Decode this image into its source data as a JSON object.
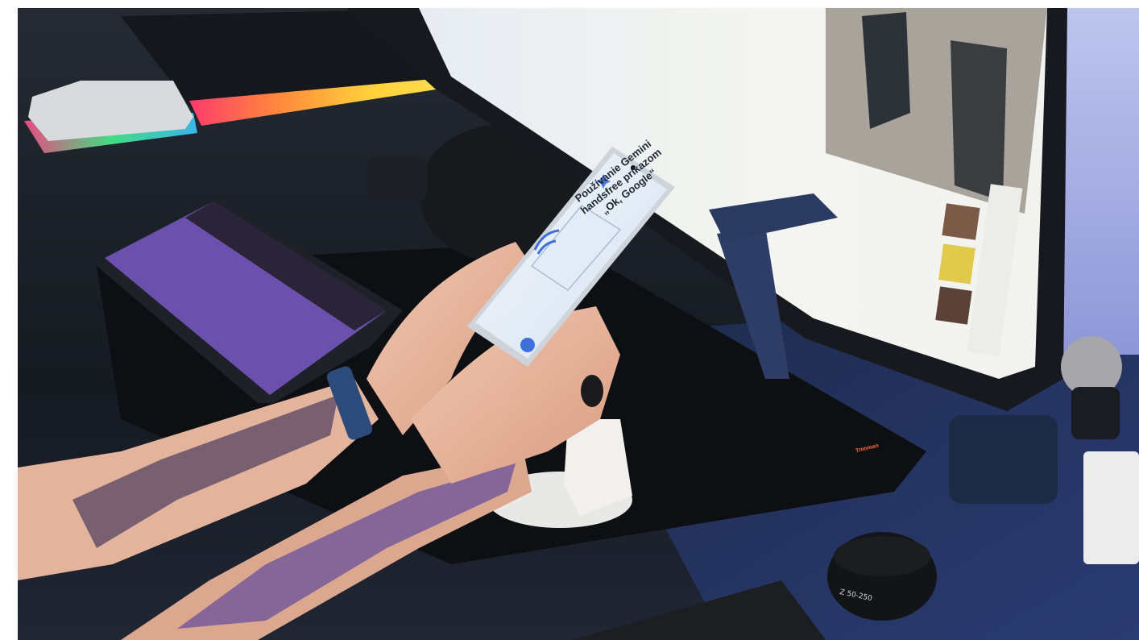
{
  "phone_screen": {
    "title_lines": [
      "Používanie Gemini",
      "handsfree príkazom",
      "„Ok, Google“"
    ]
  },
  "mousepad_label": "Trimman",
  "lens_marking": "Z 50-250"
}
